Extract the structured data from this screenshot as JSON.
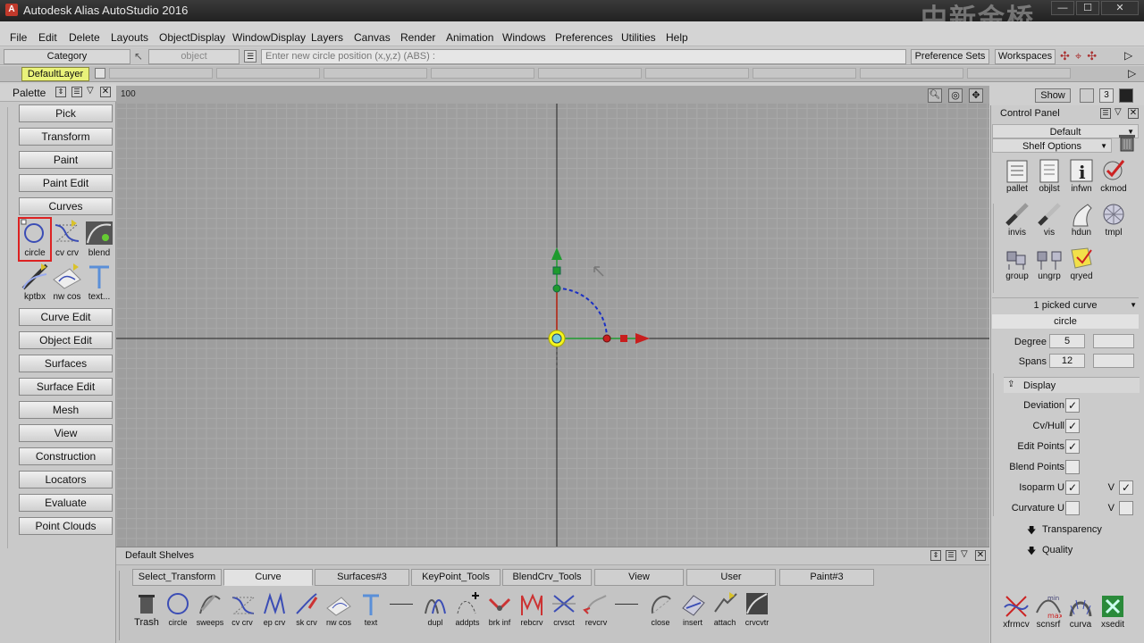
{
  "window": {
    "title": "Autodesk Alias AutoStudio 2016",
    "app_icon": "A",
    "watermark": "中新金桥",
    "min_label": "—",
    "max_label": "☐",
    "close_label": "✕"
  },
  "menu": [
    "File",
    "Edit",
    "Delete",
    "Layouts",
    "ObjectDisplay",
    "WindowDisplay",
    "Layers",
    "Canvas",
    "Render",
    "Animation",
    "Windows",
    "Preferences",
    "Utilities",
    "Help"
  ],
  "toolbar": {
    "category": "Category",
    "object": "object",
    "command_placeholder": "Enter new circle position (x,y,z) (ABS) :",
    "preference_sets": "Preference Sets",
    "workspaces": "Workspaces"
  },
  "layers": {
    "default_layer": "DefaultLayer"
  },
  "palette": {
    "title": "Palette",
    "buttons_top": [
      "Pick",
      "Transform",
      "Paint",
      "Paint Edit",
      "Curves"
    ],
    "curve_tools": [
      {
        "label": "circle",
        "icon": "circle-tool-icon"
      },
      {
        "label": "cv crv",
        "icon": "cv-curve-icon"
      },
      {
        "label": "blend",
        "icon": "blend-curve-icon"
      },
      {
        "label": "kptbx",
        "icon": "keypoint-toolbox-icon"
      },
      {
        "label": "nw cos",
        "icon": "new-cos-icon"
      },
      {
        "label": "text...",
        "icon": "text-tool-icon"
      }
    ],
    "buttons_bottom": [
      "Curve Edit",
      "Object Edit",
      "Surfaces",
      "Surface Edit",
      "Mesh",
      "View",
      "Construction",
      "Locators",
      "Evaluate",
      "Point Clouds"
    ]
  },
  "viewport": {
    "grid_scale": "100",
    "show_label": "Show"
  },
  "control_panel": {
    "title": "Control Panel",
    "preset": "Default",
    "shelf_options": "Shelf Options",
    "icons": [
      {
        "label": "pallet",
        "icon": "pallet-icon"
      },
      {
        "label": "objlst",
        "icon": "object-list-icon"
      },
      {
        "label": "infwn",
        "icon": "info-window-icon"
      },
      {
        "label": "ckmod",
        "icon": "check-model-icon"
      },
      {
        "label": "invis",
        "icon": "invisible-icon"
      },
      {
        "label": "vis",
        "icon": "visible-icon"
      },
      {
        "label": "hdun",
        "icon": "hide-unselected-icon"
      },
      {
        "label": "tmpl",
        "icon": "template-icon"
      },
      {
        "label": "group",
        "icon": "group-icon"
      },
      {
        "label": "ungrp",
        "icon": "ungroup-icon"
      },
      {
        "label": "qryed",
        "icon": "query-edit-icon"
      }
    ],
    "picked": "1 picked curve",
    "object_name": "circle",
    "degree_label": "Degree",
    "degree": "5",
    "spans_label": "Spans",
    "spans": "12",
    "display_header": "Display",
    "options": [
      {
        "label": "Deviation",
        "checked": true
      },
      {
        "label": "Cv/Hull",
        "checked": true
      },
      {
        "label": "Edit Points",
        "checked": true
      },
      {
        "label": "Blend Points",
        "checked": false
      },
      {
        "label": "Isoparm U",
        "checked": true,
        "v": true
      },
      {
        "label": "Curvature U",
        "checked": false,
        "v": false
      }
    ],
    "v_label": "V",
    "transparency": "Transparency",
    "quality": "Quality",
    "bottom_icons": [
      {
        "label": "xfrmcv",
        "icon": "transform-curve-icon"
      },
      {
        "label": "scnsrf",
        "icon": "scan-surface-icon"
      },
      {
        "label": "curva",
        "icon": "curvature-icon"
      },
      {
        "label": "xsedit",
        "icon": "xs-edit-icon"
      }
    ]
  },
  "shelf": {
    "title": "Default Shelves",
    "tabs": [
      "Select_Transform",
      "Curve",
      "Surfaces#3",
      "KeyPoint_Tools",
      "BlendCrv_Tools",
      "View",
      "User",
      "Paint#3"
    ],
    "active_tab": 1,
    "icons": [
      {
        "label": "Trash",
        "icon": "trash-icon"
      },
      {
        "label": "circle",
        "icon": "circle-icon"
      },
      {
        "label": "sweeps",
        "icon": "sweeps-icon"
      },
      {
        "label": "cv crv",
        "icon": "cv-curve-icon"
      },
      {
        "label": "ep crv",
        "icon": "ep-curve-icon"
      },
      {
        "label": "sk crv",
        "icon": "sketch-curve-icon"
      },
      {
        "label": "nw cos",
        "icon": "new-cos-icon"
      },
      {
        "label": "text",
        "icon": "text-icon"
      },
      {
        "label": "dupl",
        "icon": "duplicate-icon"
      },
      {
        "label": "addpts",
        "icon": "add-points-icon"
      },
      {
        "label": "brk inf",
        "icon": "break-inference-icon"
      },
      {
        "label": "rebcrv",
        "icon": "rebuild-curve-icon"
      },
      {
        "label": "crvsct",
        "icon": "curve-section-icon"
      },
      {
        "label": "revcrv",
        "icon": "reverse-curve-icon"
      },
      {
        "label": "close",
        "icon": "close-curve-icon"
      },
      {
        "label": "insert",
        "icon": "insert-icon"
      },
      {
        "label": "attach",
        "icon": "attach-icon"
      },
      {
        "label": "crvcvtr",
        "icon": "curve-convert-icon"
      }
    ]
  },
  "colors": {
    "layer_highlight": "#e9f27a",
    "selection_red": "#d22222",
    "axis_green": "#1e9a2e",
    "axis_red": "#c81e1e",
    "curve_blue": "#1a2fc4",
    "pivot_yellow": "#f5f51e"
  }
}
